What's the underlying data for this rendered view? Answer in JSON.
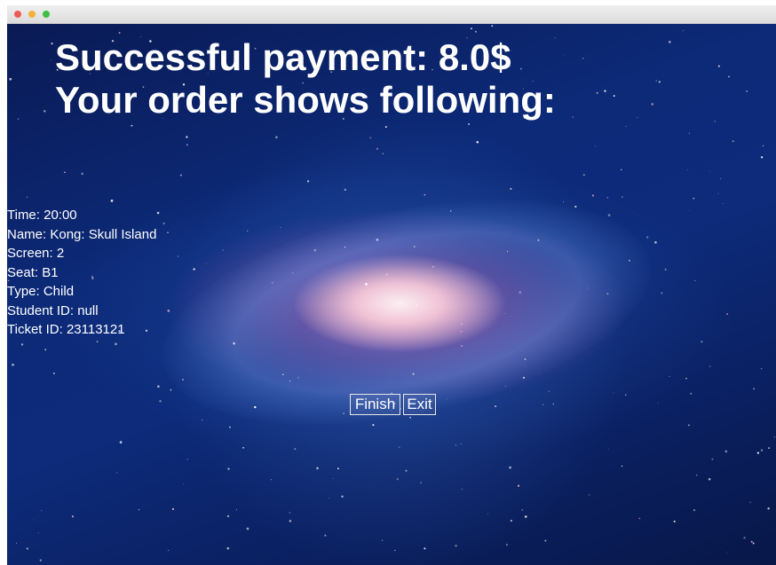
{
  "window": {
    "controls": [
      "close",
      "minimize",
      "zoom"
    ]
  },
  "headline": {
    "line1": "Successful payment: 8.0$",
    "line2": "Your order shows following:"
  },
  "order": {
    "time": "Time: 20:00",
    "name": "Name: Kong: Skull Island",
    "screen": "Screen: 2",
    "seat": "Seat: B1",
    "type": "Type: Child",
    "student_id": "Student ID: null",
    "ticket_id": "Ticket ID: 23113121"
  },
  "buttons": {
    "finish": "Finish",
    "exit": "Exit"
  },
  "colors": {
    "background": "#0c2a78",
    "text": "#ffffff",
    "galaxy_core": "#f6b7cf"
  }
}
